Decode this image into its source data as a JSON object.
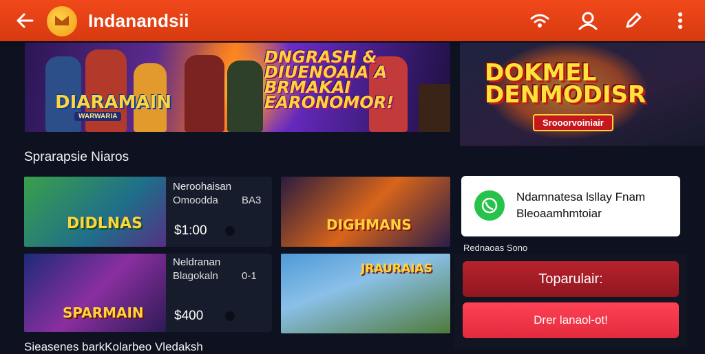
{
  "app": {
    "name": "Indanandsii"
  },
  "topbar": {
    "icons": [
      "back-arrow-icon",
      "app-logo-icon",
      "wifi-icon",
      "profile-icon",
      "edit-pencil-icon",
      "more-vertical-icon"
    ]
  },
  "hero_banner": {
    "title_left": "DIARAMAIN",
    "title_left_sub": "WARWARIA",
    "title_right": "DNGRASH & DIUENOAIA A BRMAKAI EARONOMOR!"
  },
  "promo_banner": {
    "title": "DOKMEL DENMODISR",
    "badge": "Srooorvoiniair"
  },
  "section_title": "Sprarapsie Niaros",
  "games": [
    {
      "thumb_title": "DIDLNAS",
      "name": "Neroohaisan",
      "sub": "Omoodda",
      "meta": "BA3",
      "price": "$1:00"
    },
    {
      "thumb_title": "DIGHMANS",
      "name": "",
      "sub": "",
      "meta": "",
      "price": ""
    },
    {
      "thumb_title": "SPARMAIN",
      "name": "Neldranan",
      "sub": "Blagokaln",
      "meta": "0-1",
      "price": "$400"
    },
    {
      "thumb_title": "JRAURAIAS",
      "name": "",
      "sub": "",
      "meta": "",
      "price": ""
    }
  ],
  "notification": {
    "text": "Ndamnatesa lsllay Fnam Bleoaamhmtoiar"
  },
  "side_label": "Rednaoas Sono",
  "buttons": {
    "primary": "Toparulair:",
    "secondary": "Drer lanaol-ot!"
  },
  "footer_title": "Sieasenes barkKolarbeo Vledaksh",
  "colors": {
    "topbar": "#e5421a",
    "primary_button": "#a61d27",
    "secondary_button": "#f53649",
    "whatsapp": "#27c24a",
    "background": "#0e1220"
  }
}
